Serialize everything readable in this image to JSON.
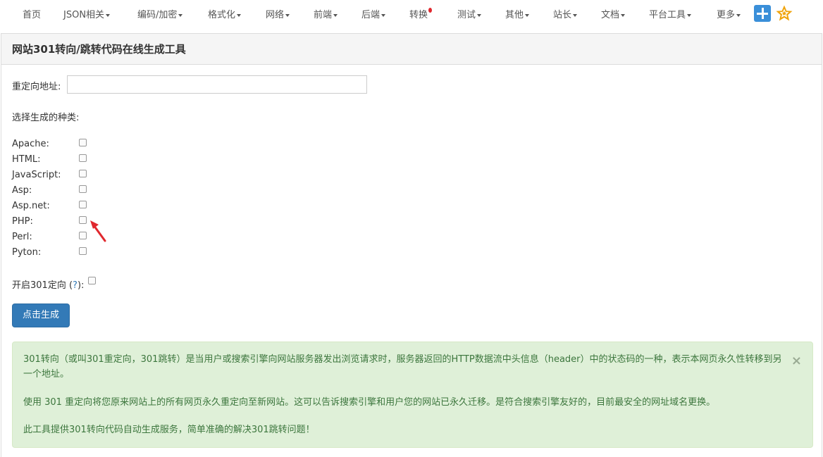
{
  "nav": {
    "items": [
      {
        "label": "首页",
        "caret": false
      },
      {
        "label": "JSON相关",
        "caret": true
      },
      {
        "label": "编码/加密",
        "caret": true
      },
      {
        "label": "格式化",
        "caret": true
      },
      {
        "label": "网络",
        "caret": true
      },
      {
        "label": "前端",
        "caret": true
      },
      {
        "label": "后端",
        "caret": true
      },
      {
        "label": "转换",
        "caret": false
      },
      {
        "label": "测试",
        "caret": true
      },
      {
        "label": "其他",
        "caret": true
      },
      {
        "label": "站长",
        "caret": true
      },
      {
        "label": "文档",
        "caret": true
      },
      {
        "label": "平台工具",
        "caret": true
      },
      {
        "label": "更多",
        "caret": true
      }
    ],
    "add_icon": "plus-icon",
    "favorite_icon": "star-icon"
  },
  "page": {
    "title": "网站301转向/跳转代码在线生成工具",
    "url_label": "重定向地址:",
    "url_value": "",
    "type_label": "选择生成的种类:",
    "options": [
      "Apache:",
      "HTML:",
      "JavaScript:",
      "Asp:",
      "Asp.net:",
      "PHP:",
      "Perl:",
      "Pyton:"
    ],
    "enable_label": "开启301定向",
    "enable_help_open": "(",
    "enable_help_q": "?",
    "enable_help_close": "):",
    "generate_button": "点击生成"
  },
  "alert": {
    "p1": "301转向（或叫301重定向，301跳转）是当用户或搜索引擎向网站服务器发出浏览请求时，服务器返回的HTTP数据流中头信息（header）中的状态码的一种，表示本网页永久性转移到另一个地址。",
    "p2": "使用 301 重定向将您原来网站上的所有网页永久重定向至新网站。这可以告诉搜索引擎和用户您的网站已永久迁移。是符合搜索引擎友好的，目前最安全的网址域名更换。",
    "p3": "此工具提供301转向代码自动生成服务，简单准确的解决301跳转问题！",
    "close": "×"
  },
  "colors": {
    "primary": "#337ab7",
    "alert_bg": "#dff0d8",
    "alert_text": "#3c763d",
    "star": "#f0a30a"
  }
}
